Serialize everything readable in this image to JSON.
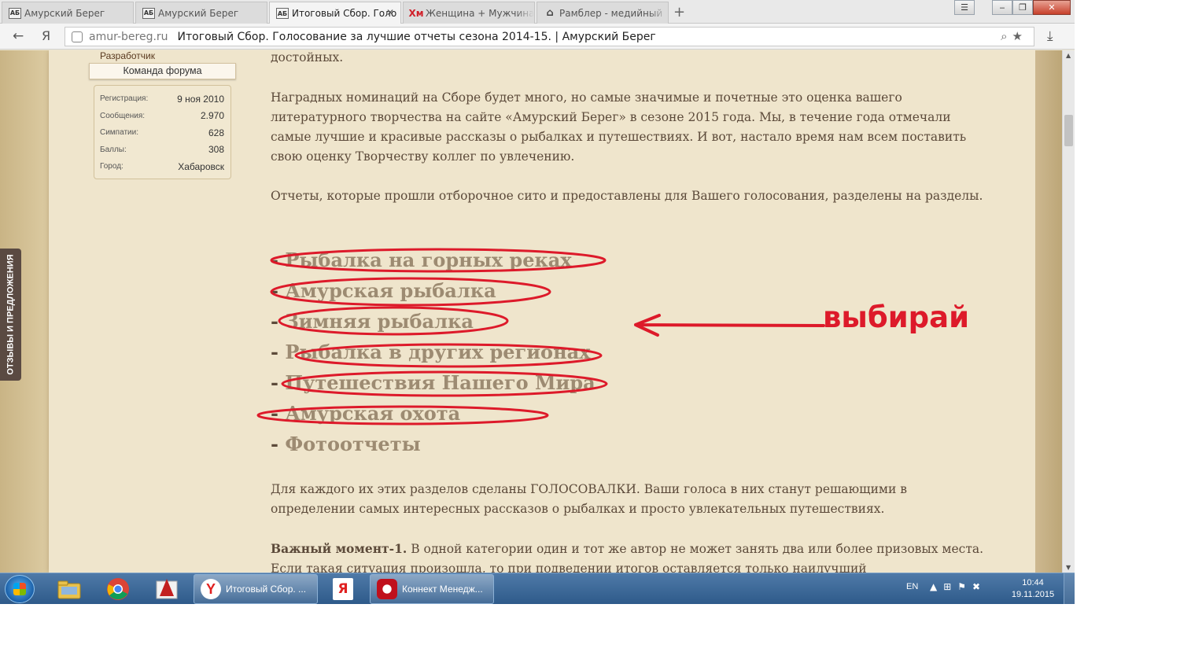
{
  "browser": {
    "tabs": [
      {
        "label": "Амурский Берег",
        "favicon": "ab-favicon-icon",
        "active": false
      },
      {
        "label": "Амурский Берег",
        "favicon": "ab-favicon-icon",
        "active": false
      },
      {
        "label": "Итоговый Сбор. Голо",
        "favicon": "ab-favicon-icon",
        "active": true
      },
      {
        "label": "Женщина + Мужчина",
        "favicon": "hm-favicon-icon",
        "active": false
      },
      {
        "label": "Рамблер - медийный",
        "favicon": "home-favicon-icon",
        "active": false
      }
    ],
    "new_tab_glyph": "+",
    "yandex_glyph": "Я",
    "address": {
      "domain": "amur-bereg.ru",
      "title": "Итоговый Сбор. Голосование за лучшие отчеты сезона 2014-15. | Амурский Берег"
    }
  },
  "sidebar": {
    "feedback_tab": "ОТЗЫВЫ И ПРЕДЛОЖЕНИЯ",
    "user_role": "Разработчик",
    "user_title": "Команда форума",
    "info": [
      {
        "key": "Регистрация:",
        "value": "9 ноя 2010"
      },
      {
        "key": "Сообщения:",
        "value": "2.970"
      },
      {
        "key": "Симпатии:",
        "value": "628"
      },
      {
        "key": "Баллы:",
        "value": "308"
      },
      {
        "key": "Город:",
        "value": "Хабаровск"
      }
    ]
  },
  "post": {
    "intro_tail": "достойных.",
    "p1": "Наградных номинаций на Сборе будет много, но самые значимые и почетные это оценка вашего литературного творчества на сайте «Амурский Берег» в сезоне 2015 года. Мы, в течение года отмечали самые лучшие и красивые рассказы о рыбалках и путешествиях. И вот, настало время нам всем поставить свою оценку Творчеству коллег по увлечению.",
    "p2": "Отчеты, которые прошли отборочное сито и предоставлены для Вашего голосования, разделены на разделы.",
    "categories": [
      "Рыбалка на горных реках",
      "Амурская рыбалка",
      "Зимняя рыбалка",
      "Рыбалка в других регионах",
      "Путешествия Нашего Мира",
      "Амурская охота",
      "Фотоотчеты"
    ],
    "dash": "-",
    "p3": "Для каждого их этих разделов сделаны ГОЛОСОВАЛКИ. Ваши голоса в них станут решающими в определении самых интересных рассказов о рыбалках и просто увлекательных путешествиях.",
    "p4_bold": "Важный момент-1.",
    "p4_rest": " В одной категории один и тот же автор не может занять два или более призовых места. Если такая ситуация произошла, то при подведении итогов оставляется только наилучший"
  },
  "annotation": {
    "label": "выбирай",
    "color": "#dd1a2a"
  },
  "taskbar": {
    "tasks": [
      {
        "label": "Итоговый Сбор. ...",
        "icon": "yandex-browser-icon"
      },
      {
        "label": "Коннект Менедж...",
        "icon": "connect-manager-icon"
      }
    ],
    "yandex_glyph": "Я",
    "lang": "EN",
    "time": "10:44",
    "date": "19.11.2015"
  },
  "colors": {
    "page_bg": "#efe5cc",
    "category_text": "#9d8b72",
    "annotation_red": "#dd1a2a"
  }
}
